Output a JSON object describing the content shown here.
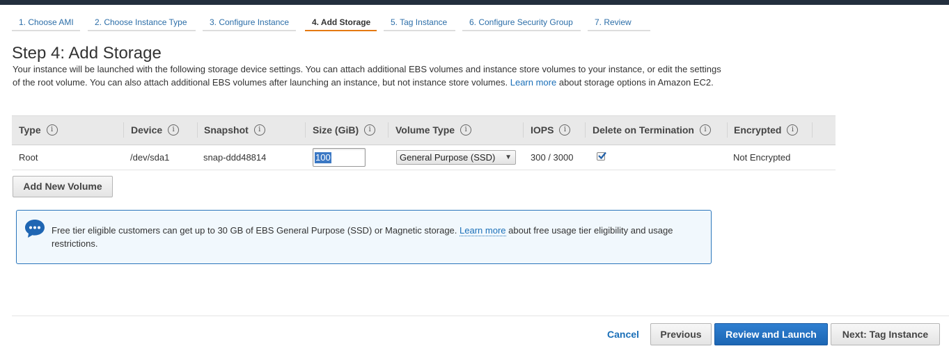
{
  "wizard": {
    "steps": [
      {
        "label": "1. Choose AMI",
        "active": false
      },
      {
        "label": "2. Choose Instance Type",
        "active": false
      },
      {
        "label": "3. Configure Instance",
        "active": false
      },
      {
        "label": "4. Add Storage",
        "active": true
      },
      {
        "label": "5. Tag Instance",
        "active": false
      },
      {
        "label": "6. Configure Security Group",
        "active": false
      },
      {
        "label": "7. Review",
        "active": false
      }
    ]
  },
  "page": {
    "title": "Step 4: Add Storage",
    "description_part1": "Your instance will be launched with the following storage device settings. You can attach additional EBS volumes and instance store volumes to your instance, or edit the settings of the root volume. You can also attach additional EBS volumes after launching an instance, but not instance store volumes.",
    "description_link": "Learn more",
    "description_part2": "about storage options in Amazon EC2."
  },
  "table": {
    "headers": [
      "Type",
      "Device",
      "Snapshot",
      "Size (GiB)",
      "Volume Type",
      "IOPS",
      "Delete on Termination",
      "Encrypted"
    ],
    "info_icon": "i",
    "rows": [
      {
        "type": "Root",
        "device": "/dev/sda1",
        "snapshot": "snap-ddd48814",
        "size": "100",
        "volume_type": "General Purpose (SSD)",
        "iops": "300 / 3000",
        "delete_on_termination": true,
        "encrypted": "Not Encrypted"
      }
    ]
  },
  "add_volume_button": "Add New Volume",
  "notice": {
    "icon": "chat-bubble-icon",
    "text_part1": "Free tier eligible customers can get up to 30 GB of EBS General Purpose (SSD) or Magnetic storage.",
    "link": "Learn more",
    "text_part2": "about free usage tier eligibility and usage restrictions."
  },
  "footer": {
    "cancel": "Cancel",
    "previous": "Previous",
    "review_launch": "Review and Launch",
    "next": "Next: Tag Instance"
  },
  "colors": {
    "accent_orange": "#e47911",
    "link_blue": "#1a6fb8",
    "primary_button": "#1c66b4",
    "notice_border": "#2a75bb",
    "notice_bg": "#f1f8fd"
  }
}
